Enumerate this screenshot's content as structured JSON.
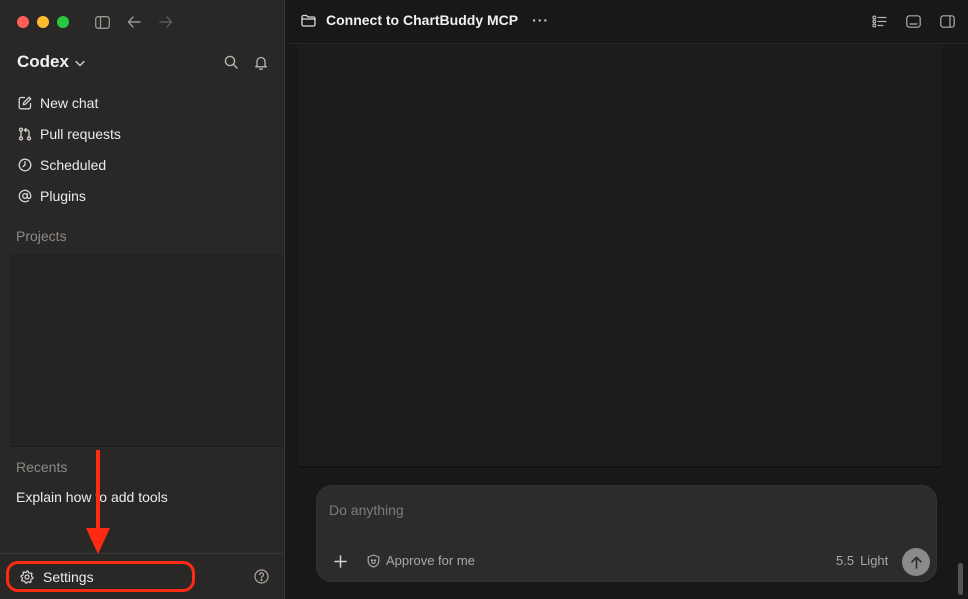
{
  "sidebar": {
    "brand": "Codex",
    "nav": [
      {
        "label": "New chat",
        "icon": "compose-icon"
      },
      {
        "label": "Pull requests",
        "icon": "pull-request-icon"
      },
      {
        "label": "Scheduled",
        "icon": "clock-icon"
      },
      {
        "label": "Plugins",
        "icon": "at-sign-icon"
      }
    ],
    "projects_label": "Projects",
    "recents_label": "Recents",
    "recents": [
      "Explain how to add tools"
    ],
    "settings_label": "Settings"
  },
  "header": {
    "thread_title": "Connect to ChartBuddy MCP",
    "more_label": "···"
  },
  "composer": {
    "placeholder": "Do anything",
    "approve_label": "Approve for me",
    "model_version": "5.5",
    "model_mode": "Light"
  },
  "colors": {
    "highlight": "#ff2a14",
    "sidebar_bg": "#2a2826",
    "main_bg": "#181818"
  }
}
